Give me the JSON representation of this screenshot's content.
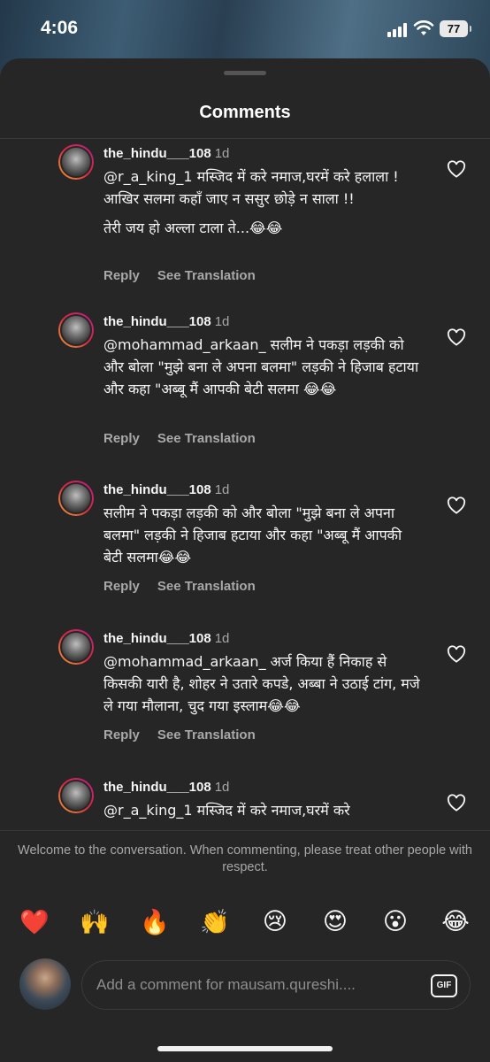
{
  "status_bar": {
    "time": "4:06",
    "battery": "77"
  },
  "sheet": {
    "title": "Comments"
  },
  "comments": [
    {
      "username": "the_hindu___108",
      "time": "1d",
      "lines": [
        "@r_a_king_1 मस्जिद में करे नमाज,घरमें करे हलाला ! आखिर सलमा कहाँ जाए न ससुर छोड़े न साला !!",
        "तेरी जय हो अल्ला टाला ते...😂😂"
      ],
      "reply": "Reply",
      "see_translation": "See Translation"
    },
    {
      "username": "the_hindu___108",
      "time": "1d",
      "lines": [
        "@mohammad_arkaan_ सलीम ने पकड़ा लड़की को और बोला \"मुझे बना ले अपना बलमा\" लड़की ने हिजाब हटाया और कहा \"अब्बू मैं आपकी बेटी सलमा 😂😂"
      ],
      "reply": "Reply",
      "see_translation": "See Translation"
    },
    {
      "username": "the_hindu___108",
      "time": "1d",
      "lines": [
        "सलीम ने पकड़ा लड़की को और बोला \"मुझे बना ले अपना बलमा\" लड़की ने हिजाब हटाया और कहा \"अब्बू मैं आपकी बेटी सलमा😂😂"
      ],
      "reply": "Reply",
      "see_translation": "See Translation"
    },
    {
      "username": "the_hindu___108",
      "time": "1d",
      "lines": [
        "@mohammad_arkaan_ अर्ज किया हैं निकाह से किसकी यारी है, शोहर ने उतारे कपडे, अब्बा ने उठाई टांग, मजे ले गया मौलाना, चुद गया इस्लाम😂😂"
      ],
      "reply": "Reply",
      "see_translation": "See Translation"
    },
    {
      "username": "the_hindu___108",
      "time": "1d",
      "lines": [
        "@r_a_king_1 मस्जिद में करे नमाज,घरमें करे"
      ],
      "reply": "",
      "see_translation": ""
    }
  ],
  "welcome_text": "Welcome to the conversation. When commenting, please treat other people with respect.",
  "quick_emojis": [
    "❤️",
    "🙌",
    "🔥",
    "👏",
    "😢",
    "😍",
    "😮",
    "😂"
  ],
  "composer": {
    "placeholder": "Add a comment for mausam.qureshi....",
    "gif_label": "GIF"
  }
}
